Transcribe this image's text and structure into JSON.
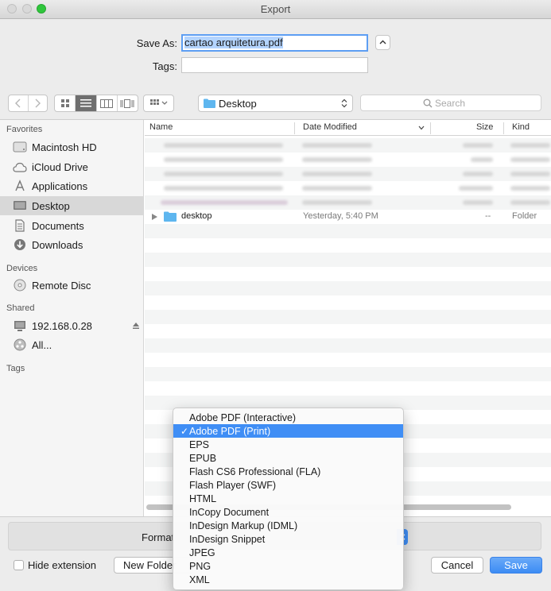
{
  "window": {
    "title": "Export"
  },
  "top": {
    "saveas_label": "Save As:",
    "saveas_value": "cartao arquitetura.pdf",
    "tags_label": "Tags:",
    "tags_value": ""
  },
  "toolbar": {
    "location": "Desktop",
    "search_placeholder": "Search"
  },
  "sidebar": {
    "favorites_header": "Favorites",
    "devices_header": "Devices",
    "shared_header": "Shared",
    "tags_header": "Tags",
    "favorites": [
      {
        "label": "Macintosh HD",
        "icon": "hard-drive-icon"
      },
      {
        "label": "iCloud Drive",
        "icon": "cloud-icon"
      },
      {
        "label": "Applications",
        "icon": "applications-icon"
      },
      {
        "label": "Desktop",
        "icon": "desktop-icon"
      },
      {
        "label": "Documents",
        "icon": "documents-icon"
      },
      {
        "label": "Downloads",
        "icon": "downloads-icon"
      }
    ],
    "devices": [
      {
        "label": "Remote Disc",
        "icon": "disc-icon"
      }
    ],
    "shared": [
      {
        "label": "192.168.0.28",
        "icon": "monitor-icon"
      },
      {
        "label": "All...",
        "icon": "network-icon"
      }
    ]
  },
  "list": {
    "columns": {
      "name": "Name",
      "date": "Date Modified",
      "size": "Size",
      "kind": "Kind"
    },
    "folder_row": {
      "name": "desktop",
      "date": "Yesterday, 5:40 PM",
      "size": "--",
      "kind": "Folder"
    }
  },
  "bottom": {
    "format_label": "Format",
    "hide_extension_label": "Hide extension",
    "new_folder_label": "New Folder",
    "cancel_label": "Cancel",
    "save_label": "Save"
  },
  "format_menu": {
    "selected_index": 1,
    "items": [
      "Adobe PDF (Interactive)",
      "Adobe PDF (Print)",
      "EPS",
      "EPUB",
      "Flash CS6 Professional (FLA)",
      "Flash Player (SWF)",
      "HTML",
      "InCopy Document",
      "InDesign Markup (IDML)",
      "InDesign Snippet",
      "JPEG",
      "PNG",
      "XML"
    ]
  },
  "colors": {
    "accent": "#3f8ef5",
    "selection": "#b3d4ff"
  }
}
